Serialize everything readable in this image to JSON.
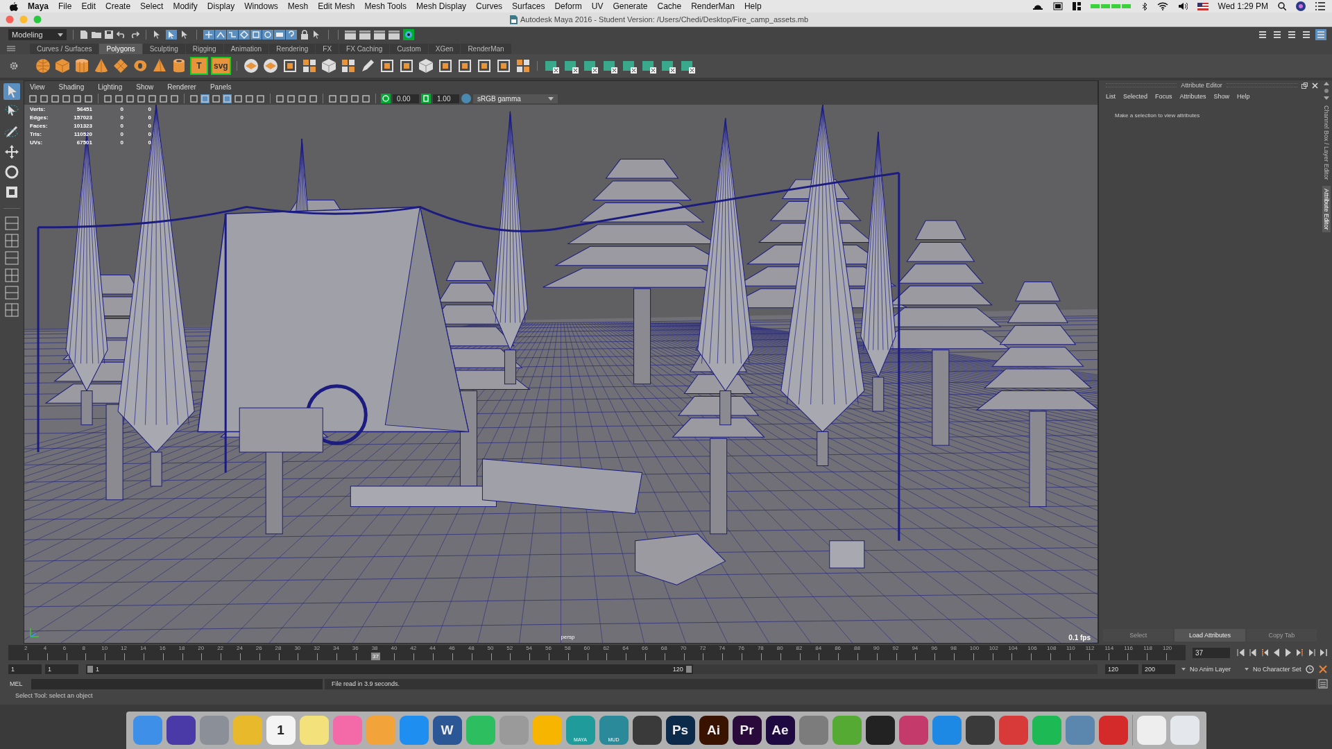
{
  "menubar": {
    "app": "Maya",
    "menus": [
      "File",
      "Edit",
      "Create",
      "Select",
      "Modify",
      "Display",
      "Windows",
      "Mesh",
      "Edit Mesh",
      "Mesh Tools",
      "Mesh Display",
      "Curves",
      "Surfaces",
      "Deform",
      "UV",
      "Generate",
      "Cache",
      "RenderMan",
      "Help"
    ],
    "clock": "Wed 1:29 PM"
  },
  "window": {
    "title": "Autodesk Maya 2016 - Student Version: /Users/Chedi/Desktop/Fire_camp_assets.mb"
  },
  "status_line": {
    "menu_set": "Modeling"
  },
  "shelf": {
    "tabs": [
      {
        "label": "Curves / Surfaces",
        "selected": false
      },
      {
        "label": "Polygons",
        "selected": true
      },
      {
        "label": "Sculpting",
        "selected": false
      },
      {
        "label": "Rigging",
        "selected": false
      },
      {
        "label": "Animation",
        "selected": false
      },
      {
        "label": "Rendering",
        "selected": false
      },
      {
        "label": "FX",
        "selected": false
      },
      {
        "label": "FX Caching",
        "selected": false
      },
      {
        "label": "Custom",
        "selected": false
      },
      {
        "label": "XGen",
        "selected": false
      },
      {
        "label": "RenderMan",
        "selected": false
      }
    ],
    "text_tools": [
      "T",
      "svg"
    ]
  },
  "toolbox": {
    "tools": [
      {
        "selected": true
      },
      {
        "selected": false
      },
      {
        "selected": false
      },
      {
        "selected": false
      },
      {
        "selected": false
      },
      {
        "selected": false
      }
    ]
  },
  "viewport": {
    "menus": [
      "View",
      "Shading",
      "Lighting",
      "Show",
      "Renderer",
      "Panels"
    ],
    "exposure": "0.00",
    "gamma": "1.00",
    "color_space": "sRGB gamma",
    "hud": [
      {
        "label": "Verts:",
        "value": "56451",
        "column_3": "0",
        "column_4": "0"
      },
      {
        "label": "Edges:",
        "value": "157023",
        "column_3": "0",
        "column_4": "0"
      },
      {
        "label": "Faces:",
        "value": "101323",
        "column_3": "0",
        "column_4": "0"
      },
      {
        "label": "Tris:",
        "value": "110520",
        "column_3": "0",
        "column_4": "0"
      },
      {
        "label": "UVs:",
        "value": "67501",
        "column_3": "0",
        "column_4": "0"
      }
    ],
    "camera": "persp",
    "fps": "0.1 fps"
  },
  "attribute_editor": {
    "title": "Attribute Editor",
    "menus": [
      "List",
      "Selected",
      "Focus",
      "Attributes",
      "Show",
      "Help"
    ],
    "message": "Make a selection to view attributes",
    "buttons": [
      {
        "label": "Select",
        "disabled": true
      },
      {
        "label": "Load Attributes",
        "disabled": false
      },
      {
        "label": "Copy Tab",
        "disabled": true
      }
    ]
  },
  "side_tabs": [
    {
      "label": "Channel Box / Layer Editor",
      "selected": false
    },
    {
      "label": "Attribute Editor",
      "selected": true
    }
  ],
  "timeline": {
    "ticks": [
      "2",
      "4",
      "6",
      "8",
      "10",
      "12",
      "14",
      "16",
      "18",
      "20",
      "22",
      "24",
      "26",
      "28",
      "30",
      "32",
      "34",
      "36",
      "38",
      "40",
      "42",
      "44",
      "46",
      "48",
      "50",
      "52",
      "54",
      "56",
      "58",
      "60",
      "62",
      "64",
      "66",
      "68",
      "70",
      "72",
      "74",
      "76",
      "78",
      "80",
      "82",
      "84",
      "86",
      "88",
      "90",
      "92",
      "94",
      "96",
      "98",
      "100",
      "102",
      "104",
      "106",
      "108",
      "110",
      "112",
      "114",
      "116",
      "118",
      "120"
    ],
    "current": "37",
    "level": 0.3,
    "frame_field": "37"
  },
  "range": {
    "level": 0.6,
    "start": "1",
    "playback_start": "1",
    "slider_start": "1",
    "slider_end": "120",
    "playback_end": "120",
    "end": "200",
    "anim_layer": "No Anim Layer",
    "character_set": "No Character Set"
  },
  "command_line": {
    "language": "MEL",
    "result": "File read in  3.9 seconds."
  },
  "help_line": "Select Tool: select an object",
  "dock": [
    {
      "color": "#3d8fe8"
    },
    {
      "color": "#4a3aa8"
    },
    {
      "color": "#8a8f98"
    },
    {
      "color": "#e8b92b"
    },
    {
      "color": "#f4f4f4",
      "label": "1"
    },
    {
      "color": "#f3e27c"
    },
    {
      "color": "#f46aa8"
    },
    {
      "color": "#f2a43a"
    },
    {
      "color": "#1f8ef1"
    },
    {
      "color": "#2b5797",
      "label": "W"
    },
    {
      "color": "#2dbe60"
    },
    {
      "color": "#9a9a9a"
    },
    {
      "color": "#f7b500"
    },
    {
      "color": "#1f9b9b",
      "caption": "MAYA"
    },
    {
      "color": "#2a8a9a",
      "caption": "MUD"
    },
    {
      "color": "#3a3a3a"
    },
    {
      "color": "#0c2a4a",
      "label": "Ps"
    },
    {
      "color": "#3a1300",
      "label": "Ai"
    },
    {
      "color": "#2a0a3a",
      "label": "Pr"
    },
    {
      "color": "#1e0a40",
      "label": "Ae"
    },
    {
      "color": "#7c7c7c"
    },
    {
      "color": "#55aa33"
    },
    {
      "color": "#222222"
    },
    {
      "color": "#c43a6a"
    },
    {
      "color": "#1e88e5"
    },
    {
      "color": "#3a3a3a"
    },
    {
      "color": "#d83a3a"
    },
    {
      "color": "#1db954"
    },
    {
      "color": "#5b86ad"
    },
    {
      "color": "#d42a2a"
    },
    {
      "color": "#eeeeee"
    },
    {
      "color": "#e4e8ec"
    }
  ]
}
